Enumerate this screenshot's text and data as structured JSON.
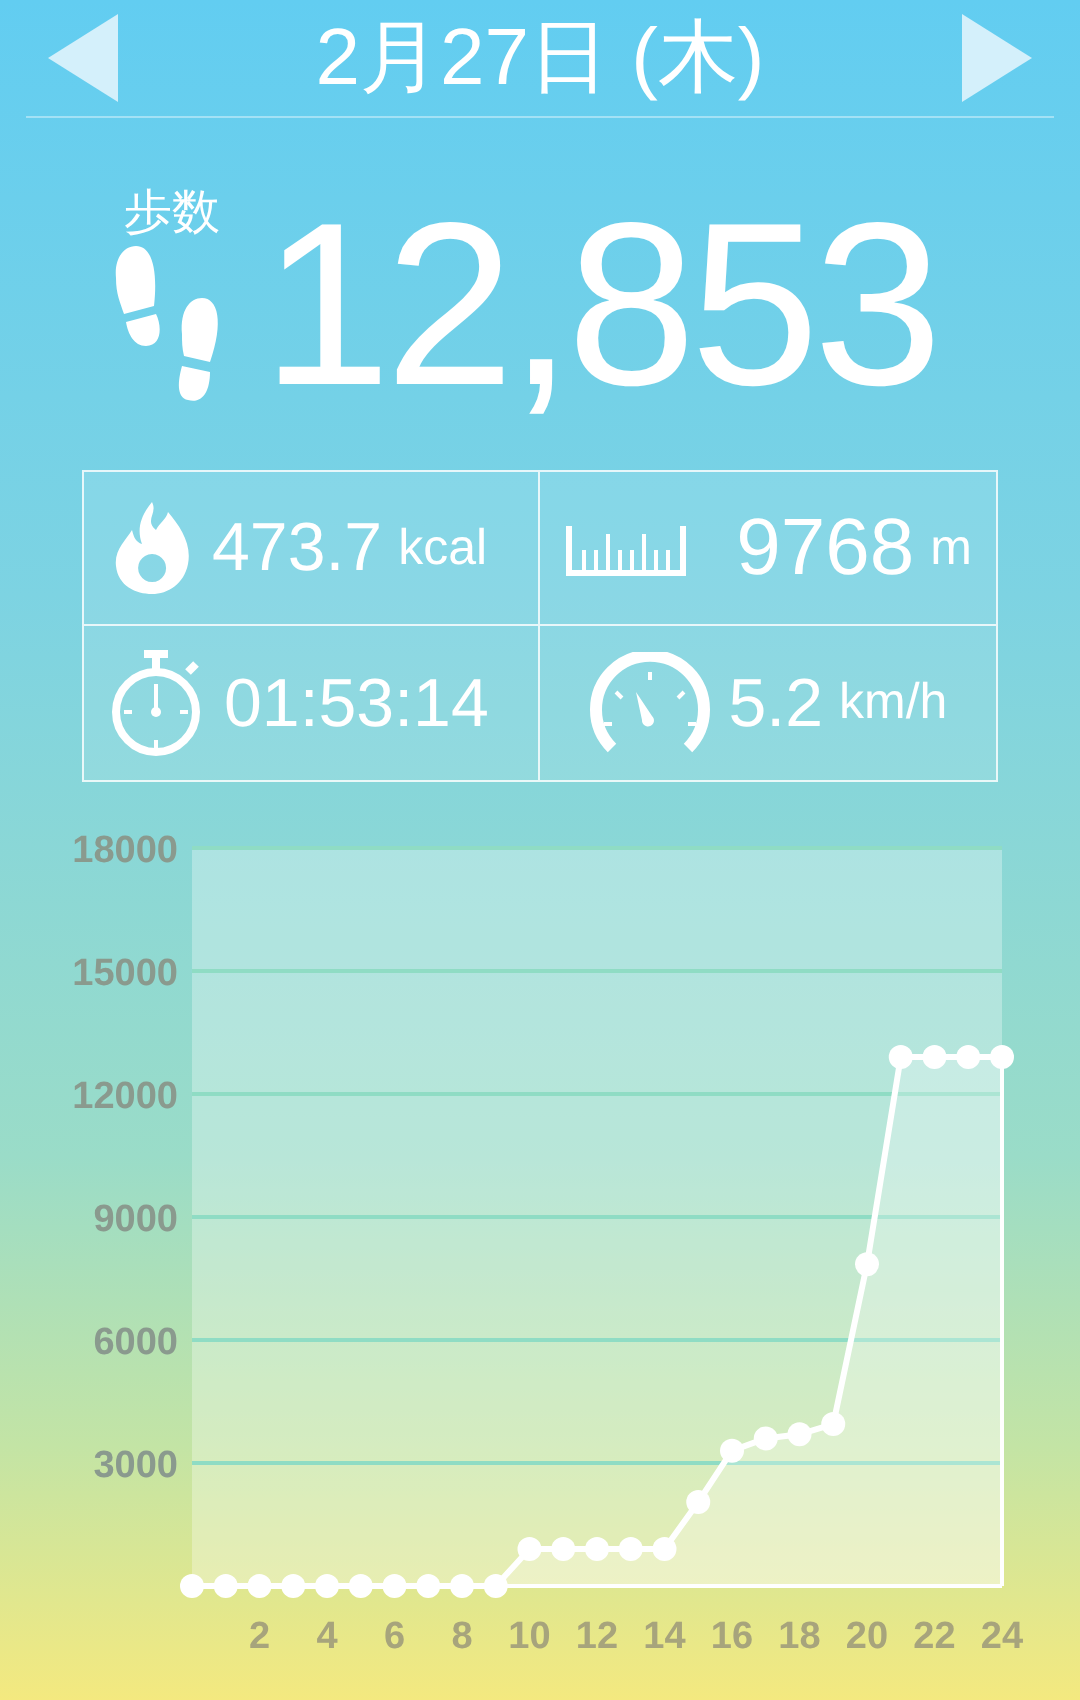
{
  "header": {
    "date": "2月27日 (木)"
  },
  "steps": {
    "label": "歩数",
    "value": "12,853"
  },
  "stats": [
    {
      "kind": "calories",
      "value": "473.7",
      "unit": "kcal"
    },
    {
      "kind": "distance",
      "value": "9768",
      "unit": "m"
    },
    {
      "kind": "duration",
      "value": "01:53:14"
    },
    {
      "kind": "speed",
      "value": "5.2",
      "unit": "km/h"
    }
  ],
  "chart": {
    "chart_data": {
      "type": "area",
      "x": [
        0,
        1,
        2,
        3,
        4,
        5,
        6,
        7,
        8,
        9,
        10,
        11,
        12,
        13,
        14,
        15,
        16,
        17,
        18,
        19,
        20,
        21,
        22,
        23,
        24
      ],
      "series": [
        {
          "color": "#ffffff",
          "values": [
            0,
            0,
            0,
            0,
            0,
            0,
            0,
            0,
            0,
            0,
            900,
            900,
            900,
            900,
            900,
            2050,
            3300,
            3600,
            3700,
            3950,
            7850,
            12900,
            12900,
            12900,
            12900
          ]
        }
      ],
      "grid": true,
      "xlim": [
        0,
        24
      ],
      "ylim": [
        0,
        18000
      ],
      "xticks": [
        2,
        4,
        6,
        8,
        10,
        12,
        14,
        16,
        18,
        20,
        22,
        24
      ],
      "yticks": [
        3000,
        6000,
        9000,
        12000,
        15000,
        18000
      ]
    }
  }
}
